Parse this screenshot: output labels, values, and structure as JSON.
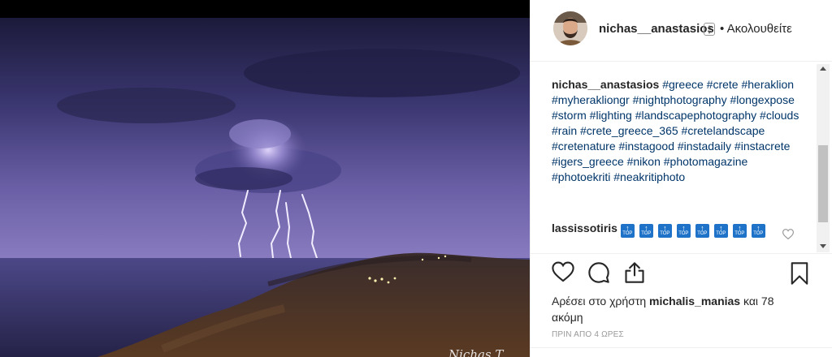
{
  "post": {
    "author": "nichas__anastasios",
    "follow_label": "• Ακολουθείτε",
    "watermark": "Nichas T"
  },
  "caption": {
    "user": "nichas__anastasios",
    "hashtags": "#greece #crete #heraklion #myherakliongr #nightphotography #longexpose #storm #lighting #landscapephotography #clouds #rain #crete_greece_365 #cretelandscape #cretenature #instagood #instadaily #instacrete #igers_greece #nikon #photomagazine #photoekriti #neakritiphoto"
  },
  "comment": {
    "user": "lassissotiris",
    "emoji_label": "TOP",
    "emoji_count": 8
  },
  "likes": {
    "prefix": "Αρέσει στο χρήστη",
    "user": "michalis_manias",
    "suffix": "και 78 ακόμη"
  },
  "timestamp": "ΠΡΙΝ ΑΠΟ 4 ΩΡΕΣ",
  "icons": {
    "like": "heart-icon",
    "comment": "comment-bubble-icon",
    "share": "share-icon",
    "save": "bookmark-icon",
    "comment_like": "small-heart-icon",
    "verified": "verified-badge-icon"
  },
  "colors": {
    "hashtag": "#003569",
    "text": "#262626",
    "muted": "#999999",
    "emoji_blue": "#1e73c8"
  }
}
